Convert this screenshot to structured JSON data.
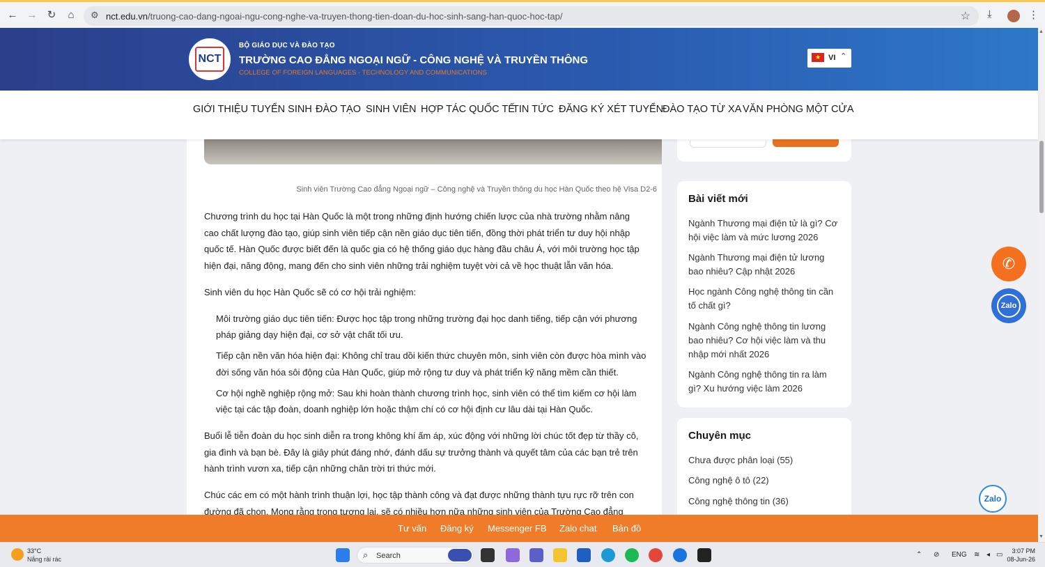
{
  "browser": {
    "url_host": "nct.edu.vn",
    "url_path": "/truong-cao-dang-ngoai-ngu-cong-nghe-va-truyen-thong-tien-doan-du-hoc-sinh-sang-han-quoc-hoc-tap/"
  },
  "header": {
    "ministry": "BỘ GIÁO DỤC VÀ ĐÀO TẠO",
    "school_name": "TRƯỜNG CAO ĐẲNG NGOẠI NGỮ - CÔNG NGHỆ VÀ TRUYỀN THÔNG",
    "school_name_en": "COLLEGE OF FOREIGN LANGUAGES - TECHNOLOGY AND COMMUNICATIONS",
    "logo_text": "NCT",
    "language": "VI"
  },
  "nav": {
    "items": [
      "GIỚI THIỆU",
      "TUYỂN SINH",
      "ĐÀO TẠO",
      "SINH VIÊN",
      "HỢP TÁC QUỐC TẾ",
      "TIN TỨC",
      "ĐĂNG KÝ XÉT TUYỂN",
      "ĐÀO TẠO TỪ XA",
      "VĂN PHÒNG MỘT CỬA"
    ]
  },
  "article": {
    "caption": "Sinh viên Trường Cao đẳng Ngoại ngữ – Công nghệ và Truyền thông du học Hàn Quốc theo hệ Visa D2-6",
    "p1": "Chương trình du học tại Hàn Quốc là một trong những định hướng chiến lược của nhà trường nhằm nâng cao chất lượng đào tạo, giúp sinh viên tiếp cận nền giáo dục tiên tiến, đồng thời phát triển tư duy hội nhập quốc tế. Hàn Quốc được biết đến là quốc gia có hệ thống giáo dục hàng đầu châu Á, với môi trường học tập hiện đại, năng động, mang đến cho sinh viên những trải nghiệm tuyệt vời cả về học thuật lẫn văn hóa.",
    "p2": "Sinh viên du học Hàn Quốc sẽ có cơ hội trải nghiệm:",
    "bullets": [
      "Môi trường giáo dục tiên tiến: Được học tập trong những trường đại học danh tiếng, tiếp cận với phương pháp giảng dạy hiện đại, cơ sở vật chất tối ưu.",
      "Tiếp cận nền văn hóa hiện đại: Không chỉ trau dồi kiến thức chuyên môn, sinh viên còn được hòa mình vào đời sống văn hóa sôi động của Hàn Quốc, giúp mở rộng tư duy và phát triển kỹ năng mềm cần thiết.",
      "Cơ hội nghề nghiệp rộng mở: Sau khi hoàn thành chương trình học, sinh viên có thể tìm kiếm cơ hội làm việc tại các tập đoàn, doanh nghiệp lớn hoặc thậm chí có cơ hội định cư lâu dài tại Hàn Quốc."
    ],
    "p3": "Buổi lễ tiễn đoàn du học sinh diễn ra trong không khí ấm áp, xúc động với những lời chúc tốt đẹp từ thầy cô, gia đình và bạn bè. Đây là giây phút đáng nhớ, đánh dấu sự trưởng thành và quyết tâm của các bạn trẻ trên hành trình vươn xa, tiếp cận những chân trời tri thức mới.",
    "p4": "Chúc các em có một hành trình thuận lợi, học tập thành công và đạt được những thành tựu rực rỡ trên con đường đã chọn. Mong rằng trong tương lai, sẽ có nhiều hơn nữa những sinh viên của Trường Cao đẳng Ngoại ngữ – Công"
  },
  "sidebar": {
    "recent_title": "Bài viết mới",
    "recent_posts": [
      "Ngành Thương mại điện tử là gì? Cơ hội việc làm và mức lương 2026",
      "Ngành Thương mại điện tử lương bao nhiêu? Cập nhật 2026",
      "Học ngành Công nghệ thông tin cần tố chất gì?",
      "Ngành Công nghệ thông tin lương bao nhiêu? Cơ hội việc làm và thu nhập mới nhất 2026",
      "Ngành Công nghệ thông tin ra làm gì? Xu hướng việc làm 2026"
    ],
    "category_title": "Chuyên mục",
    "categories": [
      "Chưa được phân loại (55)",
      "Công nghệ ô tô (22)",
      "Công nghệ thông tin (36)"
    ]
  },
  "floating": {
    "zalo_label": "Zalo",
    "zalo_float_label": "Zalo"
  },
  "footer_bar": {
    "links": [
      "Tư vấn",
      "Đăng ký",
      "Messenger FB",
      "Zalo chat",
      "Bản đồ"
    ]
  },
  "taskbar": {
    "temperature": "33°C",
    "condition": "Nắng rải rác",
    "search_label": "Search",
    "lang": "ENG",
    "time": "3:07 PM",
    "date": "08-Jun-26"
  },
  "colors": {
    "header_gradient_start": "#2b3f8a",
    "accent_orange": "#f07c2a",
    "zalo_blue": "#2f6fd6"
  }
}
